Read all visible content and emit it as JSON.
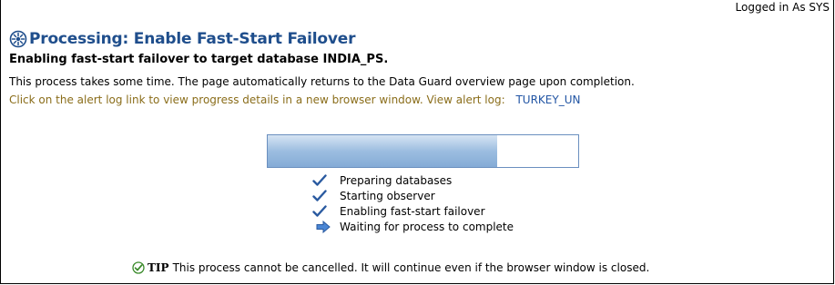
{
  "header": {
    "logged_in": "Logged in As SYS"
  },
  "page": {
    "title": "Processing: Enable Fast-Start Failover",
    "subtitle": "Enabling fast-start failover to target database INDIA_PS.",
    "description": "This process takes some time. The page automatically returns to the Data Guard overview page upon completion.",
    "alert_text": "Click on the alert log link to view progress details in a new browser window. View alert log:",
    "alert_link": "TURKEY_UN"
  },
  "progress": {
    "fraction": 0.74
  },
  "steps": [
    {
      "label": "Preparing databases",
      "status": "done",
      "icon": "checkmark-icon"
    },
    {
      "label": "Starting observer",
      "status": "done",
      "icon": "checkmark-icon"
    },
    {
      "label": "Enabling fast-start failover",
      "status": "done",
      "icon": "checkmark-icon"
    },
    {
      "label": "Waiting for process to complete",
      "status": "current",
      "icon": "arrow-right-icon"
    }
  ],
  "tip": {
    "label": "TIP",
    "text": "This process cannot be cancelled. It will continue even if the browser window is closed."
  },
  "colors": {
    "title": "#1f4e8c",
    "link": "#2255a4",
    "alert": "#8a6d1a",
    "progress": "#84abd6",
    "check": "#2a5aa0"
  }
}
